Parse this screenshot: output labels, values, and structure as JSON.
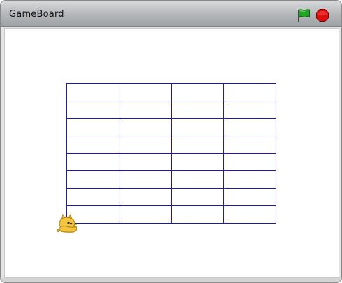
{
  "window": {
    "title": "GameBoard"
  },
  "toolbar": {
    "green_flag_icon": "green-flag-icon",
    "stop_icon": "stop-sign-icon",
    "flag_color": "#22a622",
    "stop_color": "#d81010"
  },
  "stage": {
    "background": "#ffffff",
    "grid": {
      "rows": 8,
      "cols": 4,
      "line_color": "#1c1ca0"
    },
    "sprite": {
      "icon": "cat-sprite-icon",
      "color": "#f5c542"
    }
  }
}
